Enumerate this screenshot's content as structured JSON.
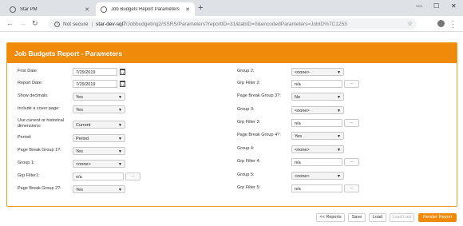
{
  "browser": {
    "tabs": [
      {
        "title": "Star PM"
      },
      {
        "title": "Job Budgets Report Parameters"
      }
    ],
    "new_tab": "+",
    "window_controls": {
      "minimize": "—",
      "maximize": "☐",
      "close": "✕"
    },
    "address": {
      "security": "Not secure",
      "host": "star-dev-sql7",
      "path": "/Jobbudgeting2/SSRS/Parameters?reportID=31&tabID=0&encodedParameters=JobID%7C1253"
    }
  },
  "panel": {
    "title": "Job Budgets Report - Parameters"
  },
  "left": {
    "first_date": {
      "label": "First Date:",
      "value": "7/29/2019"
    },
    "report_date": {
      "label": "Report Date:",
      "value": "7/29/2019"
    },
    "show_decimals": {
      "label": "Show decimals:",
      "value": "Yes"
    },
    "cover_page": {
      "label": "Include a cover page:",
      "value": "Yes"
    },
    "dimensions": {
      "label": "Use current or historical dimensions:",
      "value": "Current"
    },
    "period": {
      "label": "Period:",
      "value": "Period"
    },
    "page_break_1": {
      "label": "Page Break Group 1?:",
      "value": "Yes"
    },
    "group_1": {
      "label": "Group 1:",
      "value": "<none>"
    },
    "grp_filter_1": {
      "label": "Grp Filter1:",
      "value": "n/a",
      "button": "..."
    },
    "page_break_2": {
      "label": "Page Break Group 2?:",
      "value": "Yes"
    }
  },
  "right": {
    "group_2": {
      "label": "Group 2:",
      "value": "<none>"
    },
    "grp_filter_2": {
      "label": "Grp Filter 2:",
      "value": "n/a",
      "button": "..."
    },
    "page_break_3": {
      "label": "Page Break Group 3?:",
      "value": "No"
    },
    "group_3": {
      "label": "Group 3:",
      "value": "<none>"
    },
    "grp_filter_3": {
      "label": "Grp Filter 3:",
      "value": "n/a",
      "button": "..."
    },
    "page_break_4": {
      "label": "Page Break Group 4?:",
      "value": "Yes"
    },
    "group_4": {
      "label": "Group 4:",
      "value": "<none>"
    },
    "grp_filter_4": {
      "label": "Grp Filter 4:",
      "value": "n/a",
      "button": "..."
    },
    "group_5": {
      "label": "Group 5:",
      "value": "<none>"
    },
    "grp_filter_5": {
      "label": "Grp Filter 5:",
      "value": "n/a",
      "button": "..."
    }
  },
  "footer": {
    "reports": "<< Reports",
    "save": "Save",
    "load": "Load",
    "load_last": "Load Last",
    "render": "Render Report"
  },
  "colors": {
    "accent": "#f08a0a"
  }
}
